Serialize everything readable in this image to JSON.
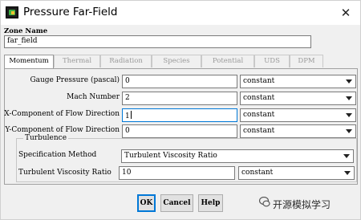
{
  "window": {
    "title": "Pressure Far-Field"
  },
  "zone": {
    "label": "Zone Name",
    "value": "far_field"
  },
  "tabs": [
    {
      "label": "Momentum",
      "active": true
    },
    {
      "label": "Thermal",
      "active": false
    },
    {
      "label": "Radiation",
      "active": false
    },
    {
      "label": "Species",
      "active": false
    },
    {
      "label": "Potential",
      "active": false
    },
    {
      "label": "UDS",
      "active": false
    },
    {
      "label": "DPM",
      "active": false
    }
  ],
  "momentum": {
    "gauge_pressure": {
      "label": "Gauge Pressure (pascal)",
      "value": "0",
      "method": "constant"
    },
    "mach_number": {
      "label": "Mach Number",
      "value": "2",
      "method": "constant"
    },
    "x_flow": {
      "label": "X-Component of Flow Direction",
      "value": "1",
      "method": "constant"
    },
    "y_flow": {
      "label": "Y-Component of Flow Direction",
      "value": "0",
      "method": "constant"
    }
  },
  "turbulence": {
    "group_label": "Turbulence",
    "spec_method": {
      "label": "Specification Method",
      "value": "Turbulent Viscosity Ratio"
    },
    "viscosity_ratio": {
      "label": "Turbulent Viscosity Ratio",
      "value": "10",
      "method": "constant"
    }
  },
  "buttons": {
    "ok": "OK",
    "cancel": "Cancel",
    "help": "Help"
  },
  "watermark": {
    "text": "开源模拟学习"
  }
}
